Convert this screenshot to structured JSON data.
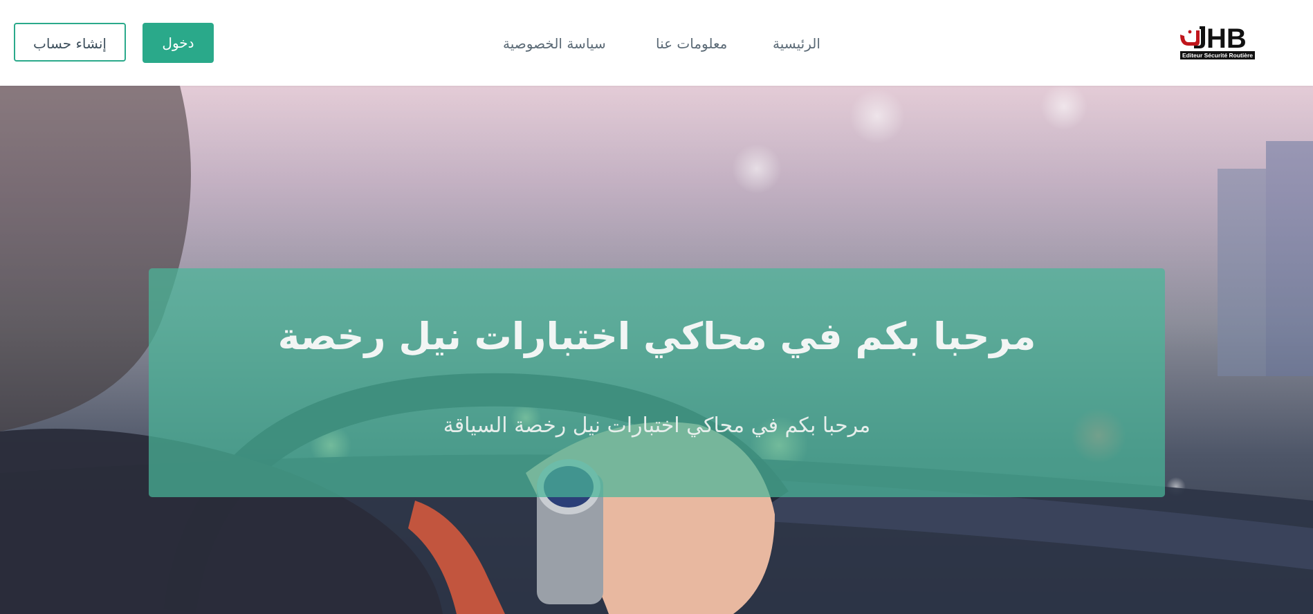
{
  "header": {
    "register_label": "إنشاء حساب",
    "login_label": "دخول",
    "nav": {
      "privacy_label": "سياسة الخصوصية",
      "about_label": "معلومات عنا",
      "home_label": "الرئيسية"
    },
    "logo": {
      "mark_text": "HB",
      "caption": "Editeur Sécurité Routière"
    }
  },
  "hero": {
    "title": "مرحبا بكم في محاكي اختبارات نيل رخصة",
    "subtitle": "مرحبا بكم في محاكي اختبارات نيل رخصة السياقة"
  },
  "colors": {
    "accent": "#2aa98a",
    "panel": "#4ab698",
    "nav_text": "#5b6a76"
  }
}
